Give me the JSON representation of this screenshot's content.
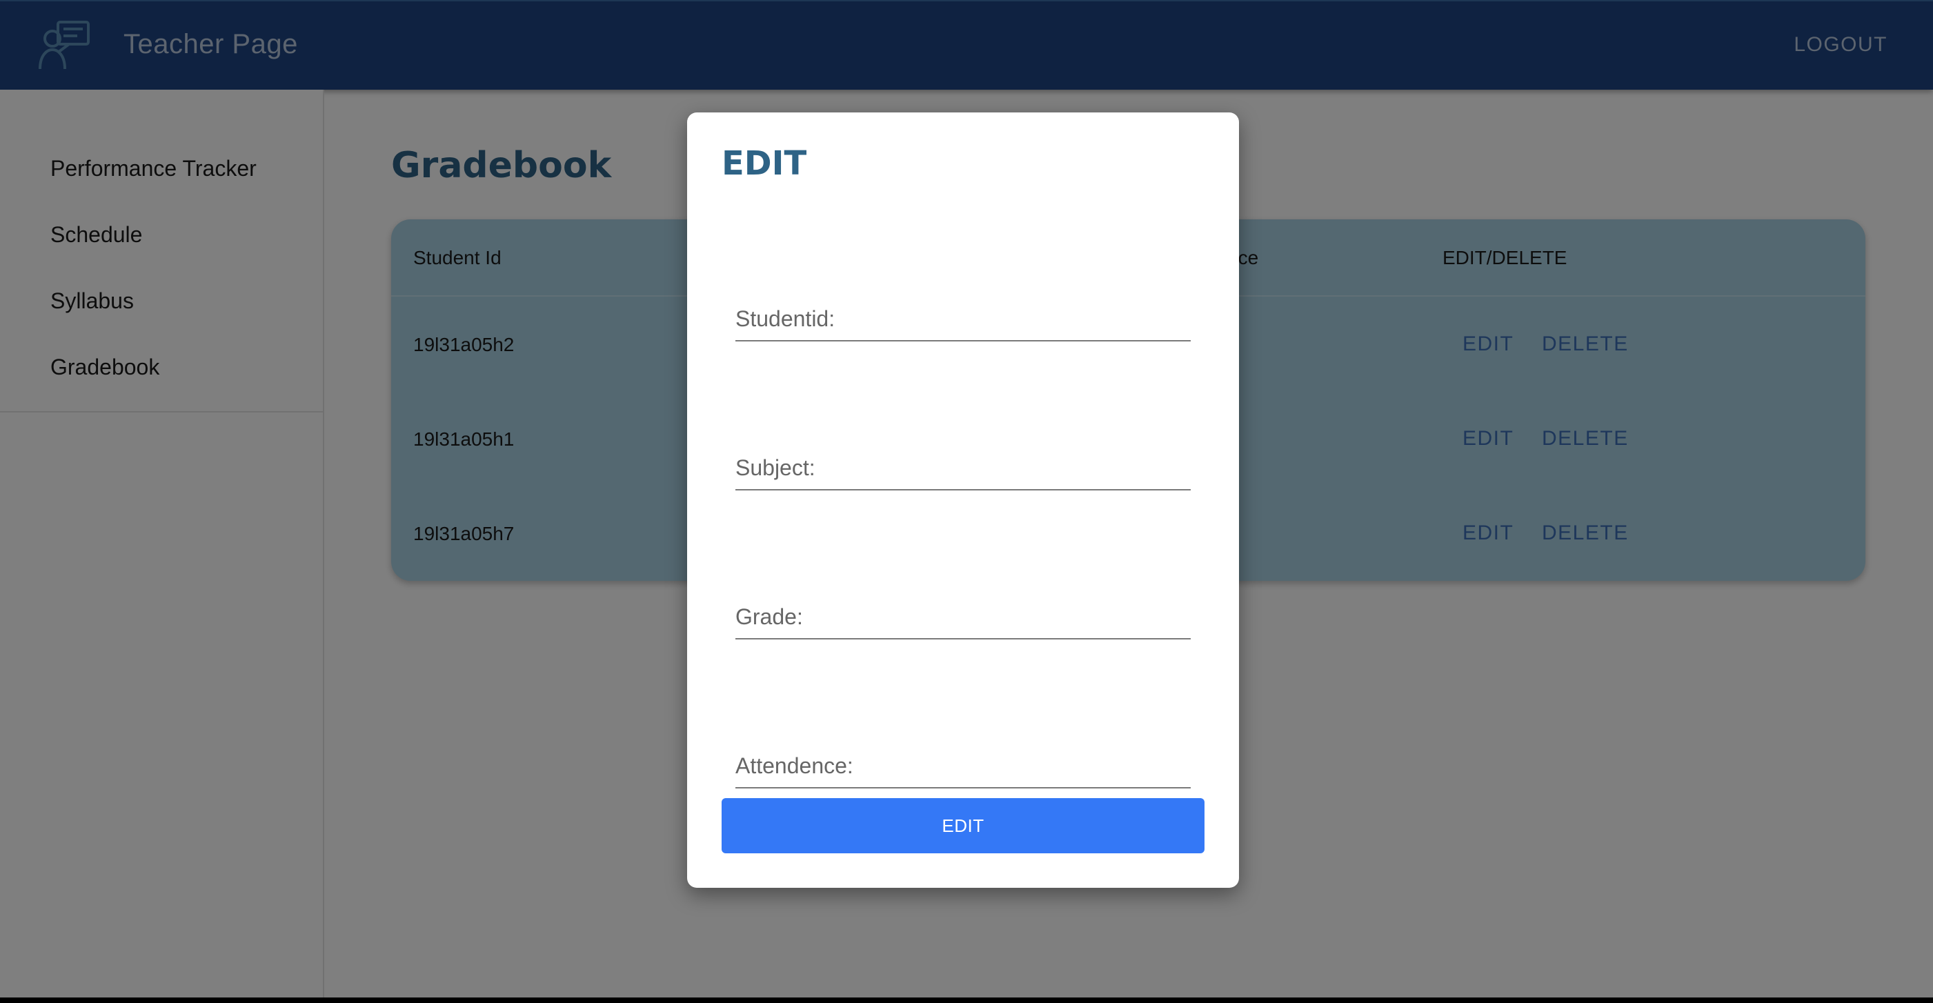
{
  "header": {
    "title": "Teacher Page",
    "logout_label": "LOGOUT",
    "logo_icon": "teacher-presentation-icon"
  },
  "sidebar": {
    "items": [
      {
        "label": "Performance Tracker"
      },
      {
        "label": "Schedule"
      },
      {
        "label": "Syllabus"
      },
      {
        "label": "Gradebook"
      }
    ]
  },
  "main": {
    "title": "Gradebook",
    "table": {
      "headers": {
        "student_id": "Student Id",
        "attendance_partial": "nce",
        "actions": "EDIT/DELETE"
      },
      "rows": [
        {
          "student_id": "19l31a05h2",
          "edit": "EDIT",
          "delete": "DELETE"
        },
        {
          "student_id": "19l31a05h1",
          "edit": "EDIT",
          "delete": "DELETE"
        },
        {
          "student_id": "19l31a05h7",
          "edit": "EDIT",
          "delete": "DELETE"
        }
      ]
    }
  },
  "dialog": {
    "title": "EDIT",
    "fields": {
      "studentid": {
        "placeholder": "Studentid:",
        "value": ""
      },
      "subject": {
        "placeholder": "Subject:",
        "value": ""
      },
      "grade": {
        "placeholder": "Grade:",
        "value": ""
      },
      "attendence": {
        "placeholder": "Attendence:",
        "value": ""
      }
    },
    "submit_label": "EDIT"
  },
  "colors": {
    "appbar": "#1f4582",
    "accent_title": "#2e6386",
    "table_bg": "#a9d0e2",
    "link": "#3d6fb6",
    "button": "#3478f6"
  }
}
